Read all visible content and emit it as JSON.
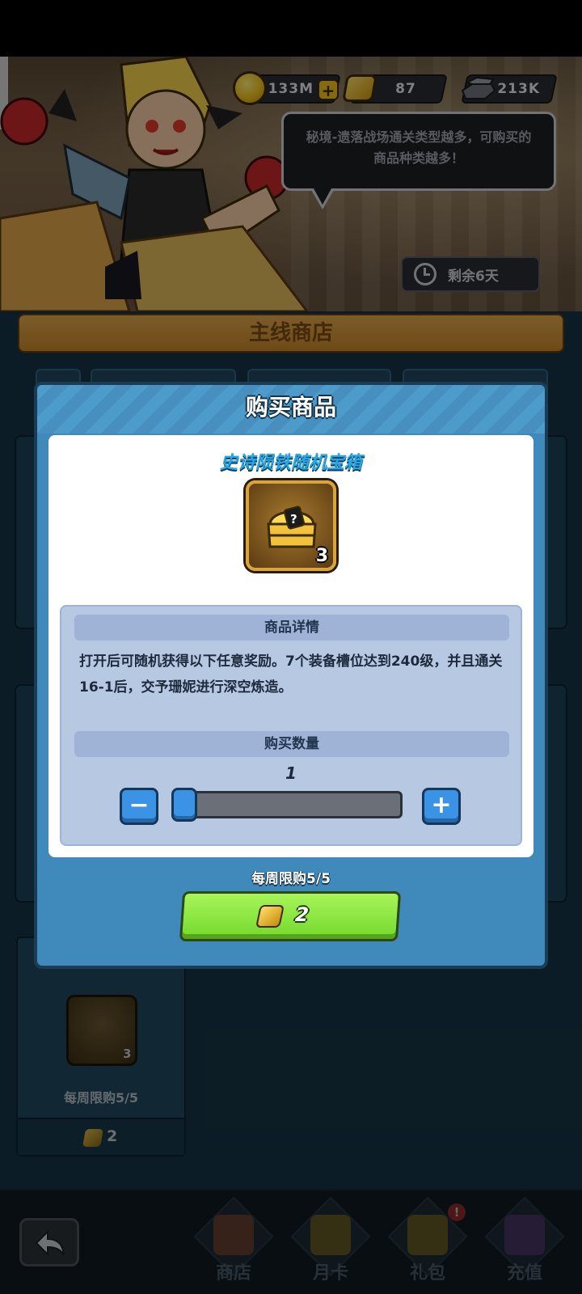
{
  "currency": {
    "gold": "133M",
    "gems": "87",
    "iron": "213K"
  },
  "banner": {
    "tip": "秘境-遗落战场通关类型越多，可购买的商品种类越多！",
    "time_left": "剩余6天"
  },
  "shop": {
    "title": "主线商店",
    "card_weekly_limit": "每周限购5/5",
    "card_price": "2",
    "card_item_qty": "3"
  },
  "modal": {
    "title": "购买商品",
    "item_name": "史诗陨铁随机宝箱",
    "item_qty": "3",
    "details_header": "商品详情",
    "details_text": "打开后可随机获得以下任意奖励。7个装备槽位达到240级，并且通关16-1后，交予珊妮进行深空炼造。",
    "quantity_header": "购买数量",
    "quantity": "1",
    "quantity_fraction": 0.0,
    "minus_label": "−",
    "plus_label": "+",
    "weekly_limit": "每周限购5/5",
    "price": "2"
  },
  "nav": {
    "items": [
      {
        "label": "商店"
      },
      {
        "label": "月卡"
      },
      {
        "label": "礼包",
        "badge": "!"
      },
      {
        "label": "充值"
      }
    ]
  }
}
